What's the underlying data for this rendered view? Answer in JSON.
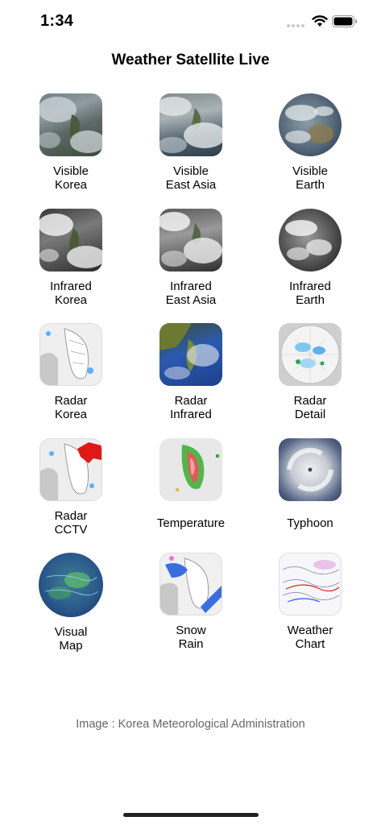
{
  "status": {
    "time": "1:34"
  },
  "header": {
    "title": "Weather Satellite Live"
  },
  "items": [
    {
      "line1": "Visible",
      "line2": "Korea",
      "icon": "satellite-visible-korea-icon"
    },
    {
      "line1": "Visible",
      "line2": "East Asia",
      "icon": "satellite-visible-east-asia-icon"
    },
    {
      "line1": "Visible",
      "line2": "Earth",
      "icon": "globe-visible-earth-icon"
    },
    {
      "line1": "Infrared",
      "line2": "Korea",
      "icon": "infrared-korea-icon"
    },
    {
      "line1": "Infrared",
      "line2": "East Asia",
      "icon": "infrared-east-asia-icon"
    },
    {
      "line1": "Infrared",
      "line2": "Earth",
      "icon": "infrared-earth-icon"
    },
    {
      "line1": "Radar",
      "line2": "Korea",
      "icon": "radar-korea-icon"
    },
    {
      "line1": "Radar",
      "line2": "Infrared",
      "icon": "radar-infrared-icon"
    },
    {
      "line1": "Radar",
      "line2": "Detail",
      "icon": "radar-detail-icon"
    },
    {
      "line1": "Radar",
      "line2": "CCTV",
      "icon": "radar-cctv-icon"
    },
    {
      "line1": "Temperature",
      "line2": "",
      "icon": "temperature-map-icon"
    },
    {
      "line1": "Typhoon",
      "line2": "",
      "icon": "typhoon-icon"
    },
    {
      "line1": "Visual",
      "line2": "Map",
      "icon": "visual-map-globe-icon"
    },
    {
      "line1": "Snow",
      "line2": "Rain",
      "icon": "snow-rain-map-icon"
    },
    {
      "line1": "Weather",
      "line2": "Chart",
      "icon": "weather-chart-icon"
    }
  ],
  "footer": {
    "credit": "Image : Korea Meteorological Administration"
  }
}
